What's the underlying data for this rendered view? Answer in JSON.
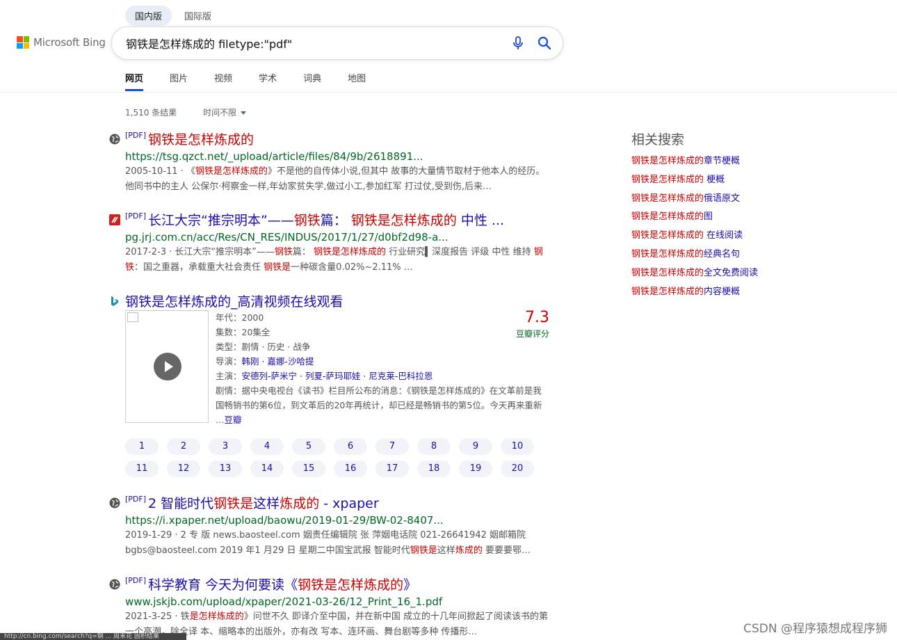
{
  "region_tabs": [
    "国内版",
    "国际版"
  ],
  "logo_text": "Microsoft Bing",
  "search": {
    "query": "钢铁是怎样炼成的 filetype:\"pdf\""
  },
  "nav_tabs": [
    "网页",
    "图片",
    "视频",
    "学术",
    "词典",
    "地图"
  ],
  "meta": {
    "result_count": "1,510 条结果",
    "time_filter": "时间不限"
  },
  "results": [
    {
      "pdf_tag": "[PDF]",
      "title_parts": [
        {
          "t": "钢铁是怎样炼成的",
          "hl": true
        }
      ],
      "url": "https://tsg.qzct.net/_upload/article/files/84/9b/2618891...",
      "snippet_parts": [
        {
          "t": "2005-10-11 · 《",
          "hl": false
        },
        {
          "t": "钢铁是怎样炼成的",
          "hl": true
        },
        {
          "t": "》不是他的自传体小说,但其中 故事的大量情节取材于他本人的经历。他同书中的主人 公保尔·柯察金一样,年幼家贫失学,做过小工,参加红军 打过仗,受到伤,后来…",
          "hl": false
        }
      ]
    },
    {
      "pdf_tag": "[PDF]",
      "title_parts": [
        {
          "t": "长江大宗“推宗明本”——",
          "hl": false
        },
        {
          "t": "钢铁",
          "hl": true
        },
        {
          "t": "篇： ",
          "hl": false
        },
        {
          "t": "钢铁是怎样炼成的",
          "hl": true
        },
        {
          "t": " 中性 ...",
          "hl": false
        }
      ],
      "url": "pg.jrj.com.cn/acc/Res/CN_RES/INDUS/2017/1/27/d0bf2d98-a...",
      "snippet_parts": [
        {
          "t": "2017-2-3 · 长江大宗“推宗明本”——",
          "hl": false
        },
        {
          "t": "钢铁",
          "hl": true
        },
        {
          "t": "篇： ",
          "hl": false
        },
        {
          "t": "钢铁是怎样炼成的",
          "hl": true
        },
        {
          "t": " 行业研究▍深度报告 评级 中性 维持 ",
          "hl": false
        },
        {
          "t": "钢铁",
          "hl": true
        },
        {
          "t": "：国之重器，承载重大社会责任 ",
          "hl": false
        },
        {
          "t": "钢铁是",
          "hl": true
        },
        {
          "t": "一种碳含量0.02%~2.11% …",
          "hl": false
        }
      ]
    }
  ],
  "video": {
    "title": "钢铁是怎样炼成的_高清视频在线观看",
    "year": "年代：2000",
    "episodes_info": "集数：20集全",
    "genre": "类型：剧情 · 历史 · 战争",
    "director_label": "导演：",
    "directors": "韩刚 · 嘉娜-沙哈提",
    "cast_label": "主演：",
    "cast": "安德列-萨米宁 · 列夏-萨玛耶娃 · 尼克莱-巴科拉恩",
    "plot": "剧情：据中央电视台《读书》栏目所公布的消息：《钢铁是怎样炼成的》在文革前是我国畅销书的第6位，到文革后的20年再统计，却已经是畅销书的第5位。今天再来重新 …",
    "plot_link": "豆瓣",
    "rating": "7.3",
    "rating_label": "豆瓣评分",
    "episodes": [
      "1",
      "2",
      "3",
      "4",
      "5",
      "6",
      "7",
      "8",
      "9",
      "10",
      "11",
      "12",
      "13",
      "14",
      "15",
      "16",
      "17",
      "18",
      "19",
      "20"
    ]
  },
  "results2": [
    {
      "pdf_tag": "[PDF]",
      "title_parts": [
        {
          "t": "2 智能时代",
          "hl": false
        },
        {
          "t": "钢铁是",
          "hl": true
        },
        {
          "t": "这样",
          "hl": false
        },
        {
          "t": "炼成的",
          "hl": true
        },
        {
          "t": " - xpaper",
          "hl": false
        }
      ],
      "url": "https://i.xpaper.net/upload/baowu/2019-01-29/BW-02-8407...",
      "snippet_parts": [
        {
          "t": "2019-1-29 · 2 专 版 news.baosteel.com 姻责任编辑院 张 萍姻电话院 021-26641942 姻邮箱院 bgbs@baosteel.com 2019 年1 月29 日 星期二中国宝武报 智能时代",
          "hl": false
        },
        {
          "t": "钢铁是",
          "hl": true
        },
        {
          "t": "这样",
          "hl": false
        },
        {
          "t": "炼成的",
          "hl": true
        },
        {
          "t": " 要要要鄂…",
          "hl": false
        }
      ]
    },
    {
      "pdf_tag": "[PDF]",
      "title_parts": [
        {
          "t": "科学教育 今天为何要读《",
          "hl": false
        },
        {
          "t": "钢铁是怎样炼成的",
          "hl": true
        },
        {
          "t": "》",
          "hl": false
        }
      ],
      "url": "www.jskjb.com/upload/xpaper/2021-03-26/12_Print_16_1.pdf",
      "snippet_parts": [
        {
          "t": "2021-3-25 · 铁",
          "hl": false
        },
        {
          "t": "是怎样炼成的",
          "hl": true
        },
        {
          "t": "》问世不久 即译介至中国，并在新中国 成立的十几年间掀起了阅读该书的第一个高潮，除全译 本、缩略本的出版外，亦有改 写本、连环画、舞台剧等多种 传播形…",
          "hl": false
        }
      ]
    }
  ],
  "related": {
    "title": "相关搜索",
    "items": [
      {
        "hl": "钢铁是怎样炼成的",
        "rest": "章节梗概"
      },
      {
        "hl": "钢铁是怎样炼成的",
        "rest": " 梗概"
      },
      {
        "hl": "钢铁是怎样炼成的",
        "rest": "俄语原文"
      },
      {
        "hl": "钢铁是怎样炼成的",
        "rest": "图"
      },
      {
        "hl": "钢铁是怎样炼成的",
        "rest": " 在线阅读"
      },
      {
        "hl": "钢铁是怎样炼成的",
        "rest": "经典名句"
      },
      {
        "hl": "钢铁是怎样炼成的",
        "rest": "全文免费阅读"
      },
      {
        "hl": "钢铁是怎样炼成的",
        "rest": "内容梗概"
      }
    ]
  },
  "watermark": "CSDN @程序猿想成程序狮",
  "statusbar": "http://cn.bing.com/search?q=钢 ... 周末花 固积结果",
  "colors": {
    "accent": "#174ae4",
    "link": "#1a0dab",
    "highlight": "#cc0000",
    "url": "#006621"
  }
}
